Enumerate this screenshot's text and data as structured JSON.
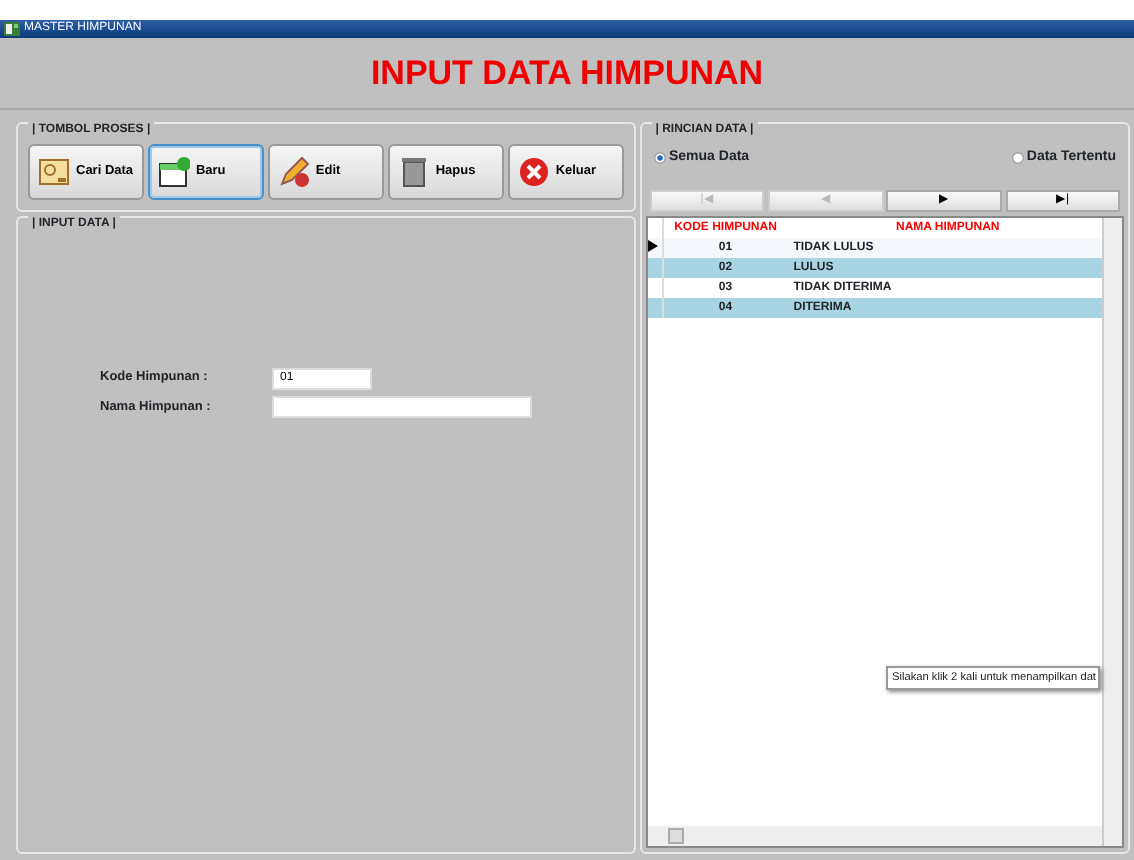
{
  "window": {
    "title": "MASTER HIMPUNAN"
  },
  "heading": "INPUT DATA HIMPUNAN",
  "tombol_proses": {
    "legend": "| TOMBOL PROSES |",
    "buttons": [
      {
        "label": "Cari Data",
        "kind": "search",
        "focused": false
      },
      {
        "label": "Baru",
        "kind": "new",
        "focused": true
      },
      {
        "label": "Edit",
        "kind": "edit",
        "focused": false
      },
      {
        "label": "Hapus",
        "kind": "delete",
        "focused": false
      },
      {
        "label": "Keluar",
        "kind": "exit",
        "focused": false
      }
    ]
  },
  "input_data": {
    "legend": "| INPUT DATA |",
    "fields": [
      {
        "label": "Kode Himpunan  :",
        "value": "01",
        "kind": "short"
      },
      {
        "label": "Nama Himpunan :",
        "kind": "long"
      }
    ]
  },
  "rincian_data": {
    "legend": "| RINCIAN DATA |",
    "radios": [
      {
        "label": "Semua Data",
        "selected": true
      },
      {
        "label": "Data Tertentu",
        "selected": false
      }
    ],
    "nav_buttons": [
      {
        "label": "|◀",
        "disabled": true
      },
      {
        "label": "◀",
        "disabled": true
      },
      {
        "label": "▶",
        "disabled": false
      },
      {
        "label": "▶|",
        "disabled": false
      }
    ],
    "table": {
      "columns": [
        "KODE HIMPUNAN",
        "NAMA HIMPUNAN"
      ],
      "rows": [
        {
          "cells": [
            "01",
            "TIDAK LULUS"
          ],
          "current": true
        },
        {
          "cells": [
            "02",
            "LULUS"
          ],
          "current": false
        },
        {
          "cells": [
            "03",
            "TIDAK DITERIMA"
          ],
          "current": false
        },
        {
          "cells": [
            "04",
            "DITERIMA"
          ],
          "current": false
        }
      ]
    },
    "tooltip": "Silakan klik 2 kali untuk menampilkan dat"
  }
}
